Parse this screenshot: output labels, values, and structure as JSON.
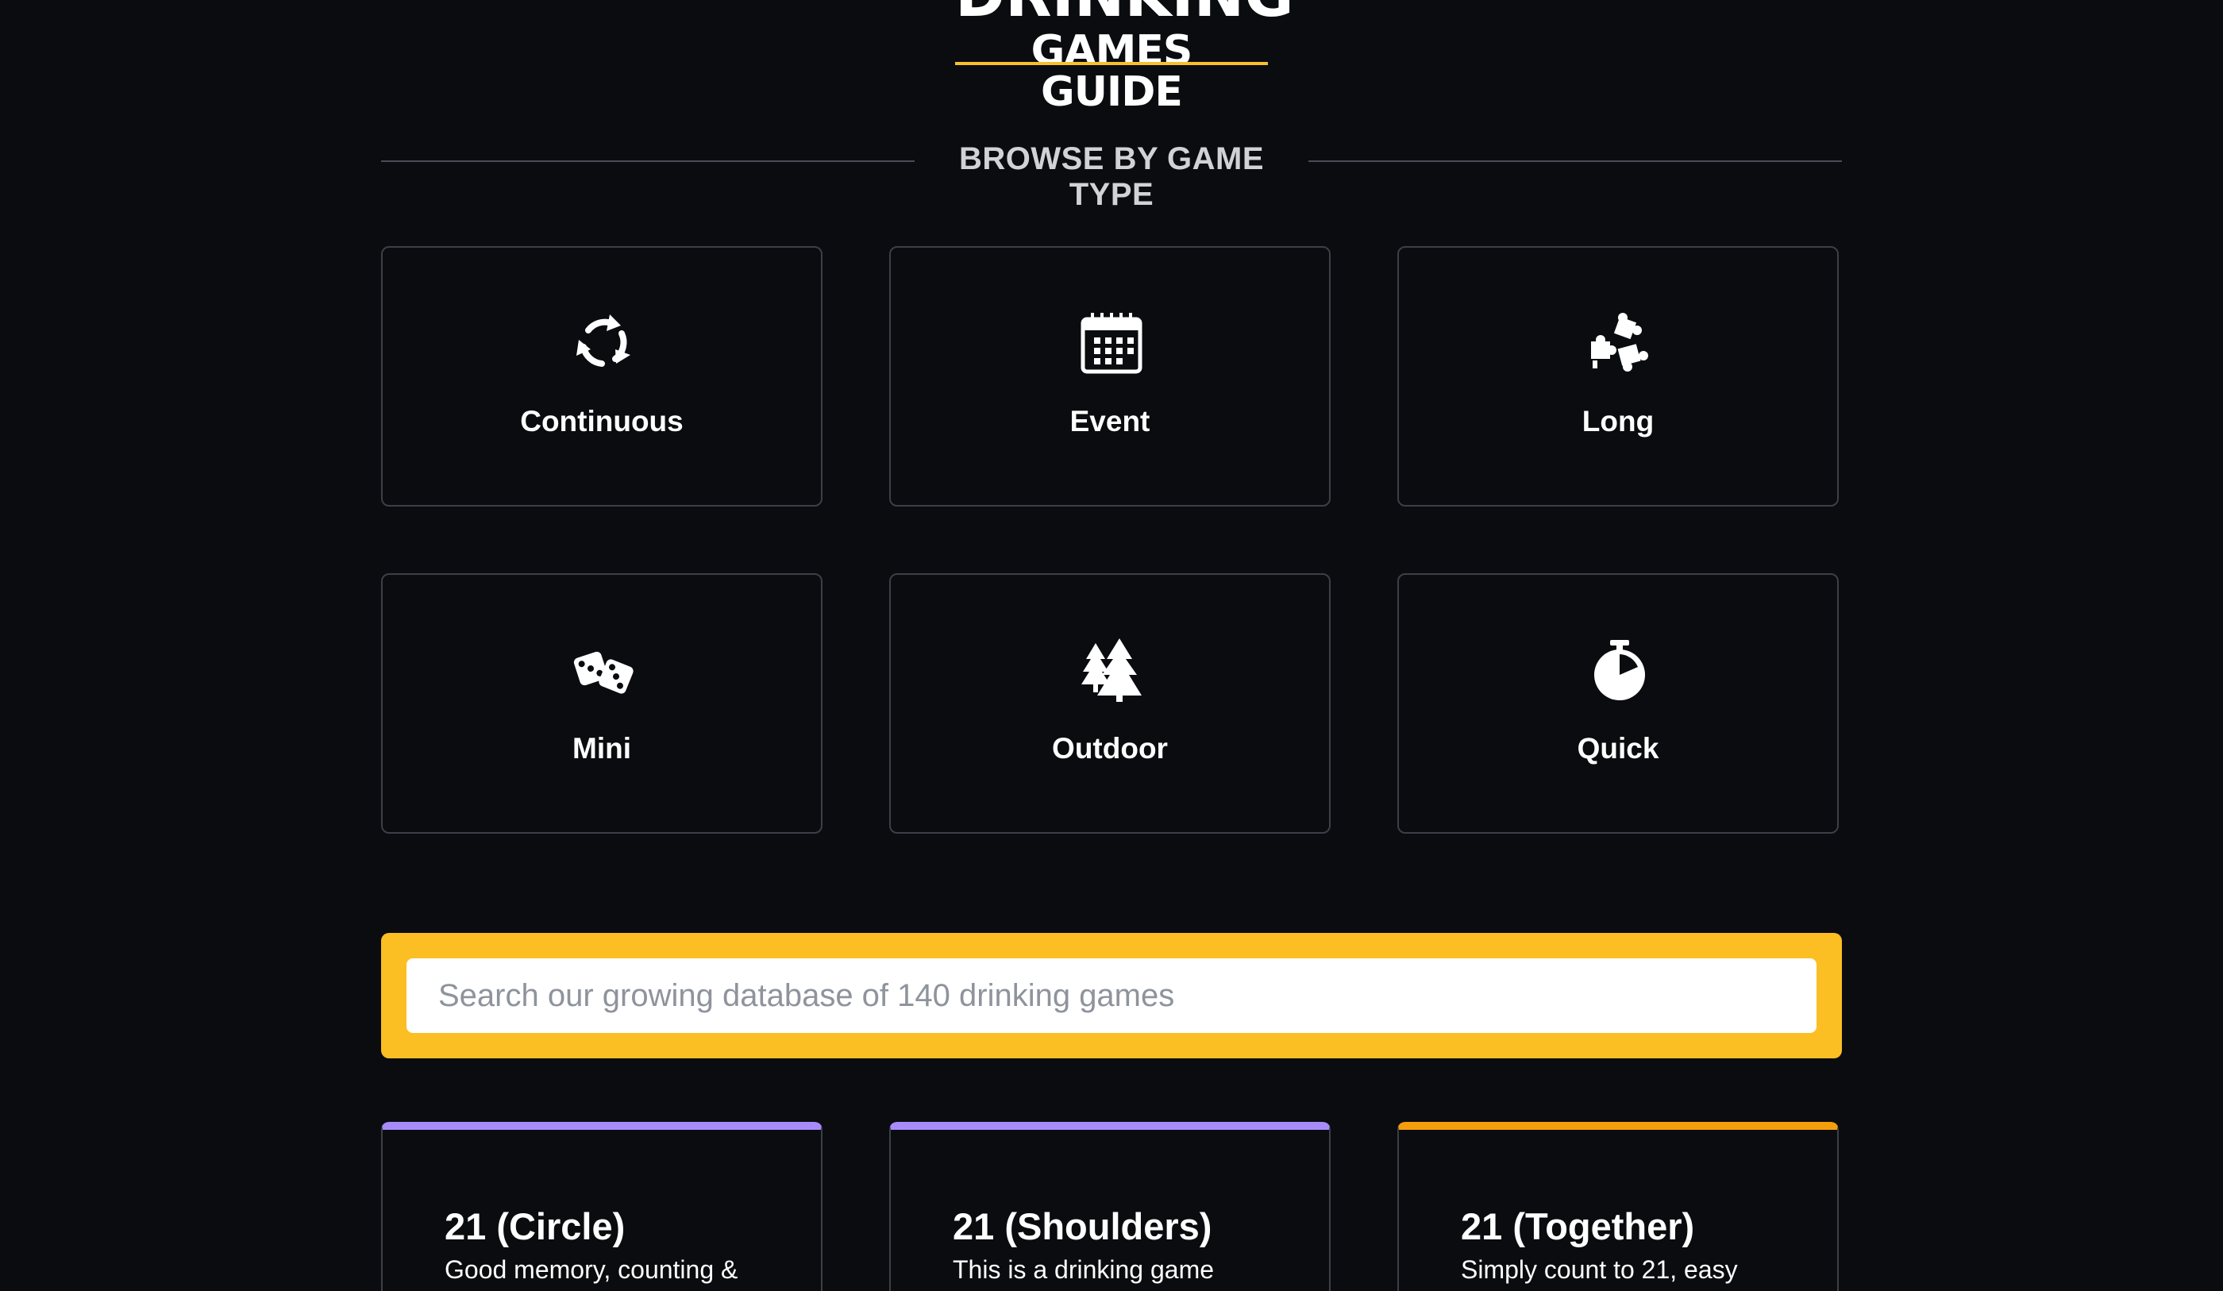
{
  "logo": {
    "line1": "DRINKING",
    "line2": "GAMES GUIDE"
  },
  "section": {
    "title": "BROWSE BY GAME TYPE"
  },
  "categories": [
    {
      "label": "Continuous",
      "icon": "refresh-icon"
    },
    {
      "label": "Event",
      "icon": "calendar-icon"
    },
    {
      "label": "Long",
      "icon": "puzzle-icon"
    },
    {
      "label": "Mini",
      "icon": "dice-icon"
    },
    {
      "label": "Outdoor",
      "icon": "trees-icon"
    },
    {
      "label": "Quick",
      "icon": "stopwatch-icon"
    }
  ],
  "search": {
    "placeholder": "Search our growing database of 140 drinking games"
  },
  "games": [
    {
      "title": "21 (Circle)",
      "description": "Good memory, counting &",
      "accent": "#a78bfa"
    },
    {
      "title": "21 (Shoulders)",
      "description": "This is a drinking game",
      "accent": "#a78bfa"
    },
    {
      "title": "21 (Together)",
      "description": "Simply count to 21, easy",
      "accent": "#f59e0b"
    }
  ],
  "colors": {
    "background": "#0a0c10",
    "brand_yellow": "#fbbf24",
    "card_border": "#3c3f47"
  }
}
